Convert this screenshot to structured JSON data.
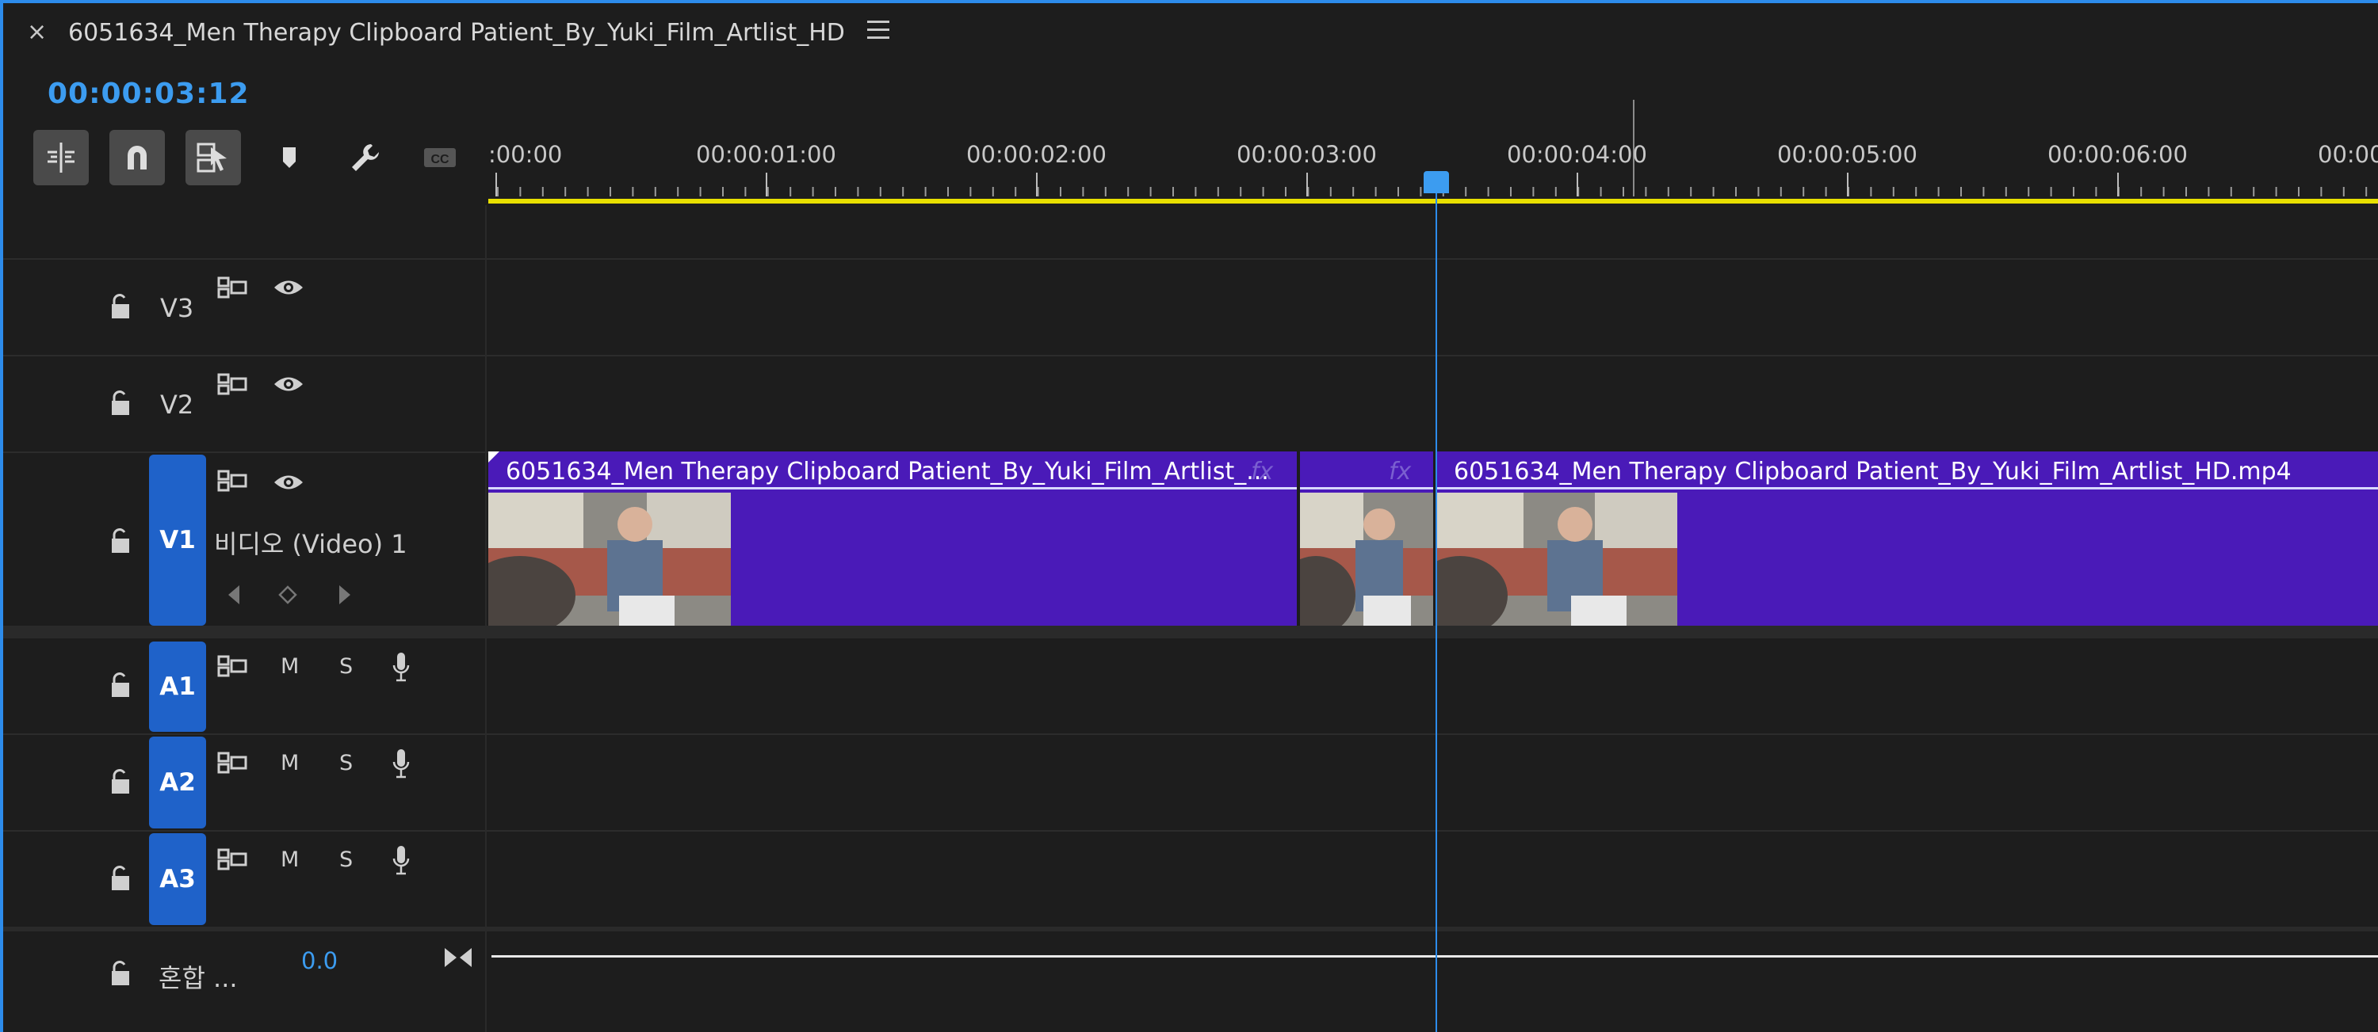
{
  "header": {
    "close_label": "×",
    "sequence_title": "6051634_Men Therapy Clipboard Patient_By_Yuki_Film_Artlist_HD",
    "timecode": "00:00:03:12"
  },
  "toolbar": {
    "tools": [
      "insert-sequence-as-nest",
      "snap",
      "linked-selection",
      "add-marker",
      "timeline-settings",
      "captions"
    ]
  },
  "ruler": {
    "labels": [
      ":00:00",
      "00:00:01:00",
      "00:00:02:00",
      "00:00:03:00",
      "00:00:04:00",
      "00:00:05:00",
      "00:00:06:00",
      "00:00"
    ]
  },
  "tracks": {
    "video": [
      {
        "id": "V3",
        "label": "V3"
      },
      {
        "id": "V2",
        "label": "V2"
      },
      {
        "id": "V1",
        "label": "V1",
        "name": "비디오 (Video) 1"
      }
    ],
    "audio": [
      {
        "id": "A1",
        "label": "A1",
        "mute": "M",
        "solo": "S"
      },
      {
        "id": "A2",
        "label": "A2",
        "mute": "M",
        "solo": "S"
      },
      {
        "id": "A3",
        "label": "A3",
        "mute": "M",
        "solo": "S"
      }
    ],
    "mix": {
      "label": "혼합 ...",
      "value": "0.0"
    }
  },
  "clips": [
    {
      "title": "6051634_Men Therapy Clipboard Patient_By_Yuki_Film_Artlist_...",
      "fx": "fx"
    },
    {
      "title": "",
      "fx": "fx"
    },
    {
      "title": "6051634_Men Therapy Clipboard Patient_By_Yuki_Film_Artlist_HD.mp4",
      "fx": ""
    }
  ],
  "colors": {
    "accent": "#2d8ceb",
    "clip": "#4a1ab8",
    "track_tag": "#1f62c9",
    "work_area": "#e9e000"
  }
}
